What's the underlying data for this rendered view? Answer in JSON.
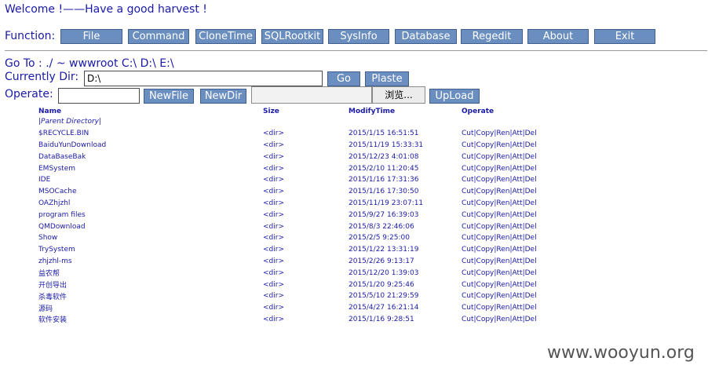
{
  "welcome": "Welcome !——Have a good harvest !",
  "function_label": "Function:",
  "functions": [
    "File",
    "Command",
    "CloneTime",
    "SQLRootkit",
    "SysInfo",
    "Database",
    "Regedit",
    "About",
    "Exit"
  ],
  "goto": {
    "label": "Go To :",
    "links": [
      "./",
      "~",
      "wwwroot",
      "C:\\",
      "D:\\",
      "E:\\"
    ]
  },
  "current_dir": {
    "label": "Currently Dir:",
    "value": "D:\\",
    "go_label": "Go",
    "paste_label": "Plaste"
  },
  "operate": {
    "label": "Operate:",
    "newfile_label": "NewFile",
    "newdir_label": "NewDir",
    "browse_label": "浏览...",
    "upload_label": "UpLoad"
  },
  "table": {
    "headers": [
      "Name",
      "Size",
      "ModifyTime",
      "Operate"
    ],
    "parent_link": "|Parent Directory|",
    "rows": [
      {
        "name": "$RECYCLE.BIN",
        "size": "<dir>",
        "time": "2015/1/15 16:51:51",
        "ops": "Cut|Copy|Ren|Att|Del"
      },
      {
        "name": "BaiduYunDownload",
        "size": "<dir>",
        "time": "2015/11/19 15:33:31",
        "ops": "Cut|Copy|Ren|Att|Del"
      },
      {
        "name": "DataBaseBak",
        "size": "<dir>",
        "time": "2015/12/23 4:01:08",
        "ops": "Cut|Copy|Ren|Att|Del"
      },
      {
        "name": "EMSystem",
        "size": "<dir>",
        "time": "2015/2/10 11:20:45",
        "ops": "Cut|Copy|Ren|Att|Del"
      },
      {
        "name": "IDE",
        "size": "<dir>",
        "time": "2015/1/16 17:31:36",
        "ops": "Cut|Copy|Ren|Att|Del"
      },
      {
        "name": "MSOCache",
        "size": "<dir>",
        "time": "2015/1/16 17:30:50",
        "ops": "Cut|Copy|Ren|Att|Del"
      },
      {
        "name": "OAZhjzhl",
        "size": "<dir>",
        "time": "2015/11/19 23:07:11",
        "ops": "Cut|Copy|Ren|Att|Del"
      },
      {
        "name": "program files",
        "size": "<dir>",
        "time": "2015/9/27 16:39:03",
        "ops": "Cut|Copy|Ren|Att|Del"
      },
      {
        "name": "QMDownload",
        "size": "<dir>",
        "time": "2015/8/3 22:46:06",
        "ops": "Cut|Copy|Ren|Att|Del"
      },
      {
        "name": "Show",
        "size": "<dir>",
        "time": "2015/2/5 9:25:00",
        "ops": "Cut|Copy|Ren|Att|Del"
      },
      {
        "name": "TrySystem",
        "size": "<dir>",
        "time": "2015/1/22 13:31:19",
        "ops": "Cut|Copy|Ren|Att|Del"
      },
      {
        "name": "zhjzhl-ms",
        "size": "<dir>",
        "time": "2015/2/26 9:13:17",
        "ops": "Cut|Copy|Ren|Att|Del"
      },
      {
        "name": "益农帮",
        "size": "<dir>",
        "time": "2015/12/20 1:39:03",
        "ops": "Cut|Copy|Ren|Att|Del"
      },
      {
        "name": "开创导出",
        "size": "<dir>",
        "time": "2015/1/20 9:25:46",
        "ops": "Cut|Copy|Ren|Att|Del"
      },
      {
        "name": "杀毒软件",
        "size": "<dir>",
        "time": "2015/5/10 21:29:59",
        "ops": "Cut|Copy|Ren|Att|Del"
      },
      {
        "name": "源码",
        "size": "<dir>",
        "time": "2015/4/27 16:21:14",
        "ops": "Cut|Copy|Ren|Att|Del"
      },
      {
        "name": "软件安装",
        "size": "<dir>",
        "time": "2015/1/16 9:28:51",
        "ops": "Cut|Copy|Ren|Att|Del"
      }
    ]
  },
  "watermark": "www.wooyun.org",
  "colors": {
    "text": "#1a1aa6",
    "button": "#6a8ec0",
    "button_border": "#3f5f8f",
    "rule": "#9a9a9a"
  }
}
